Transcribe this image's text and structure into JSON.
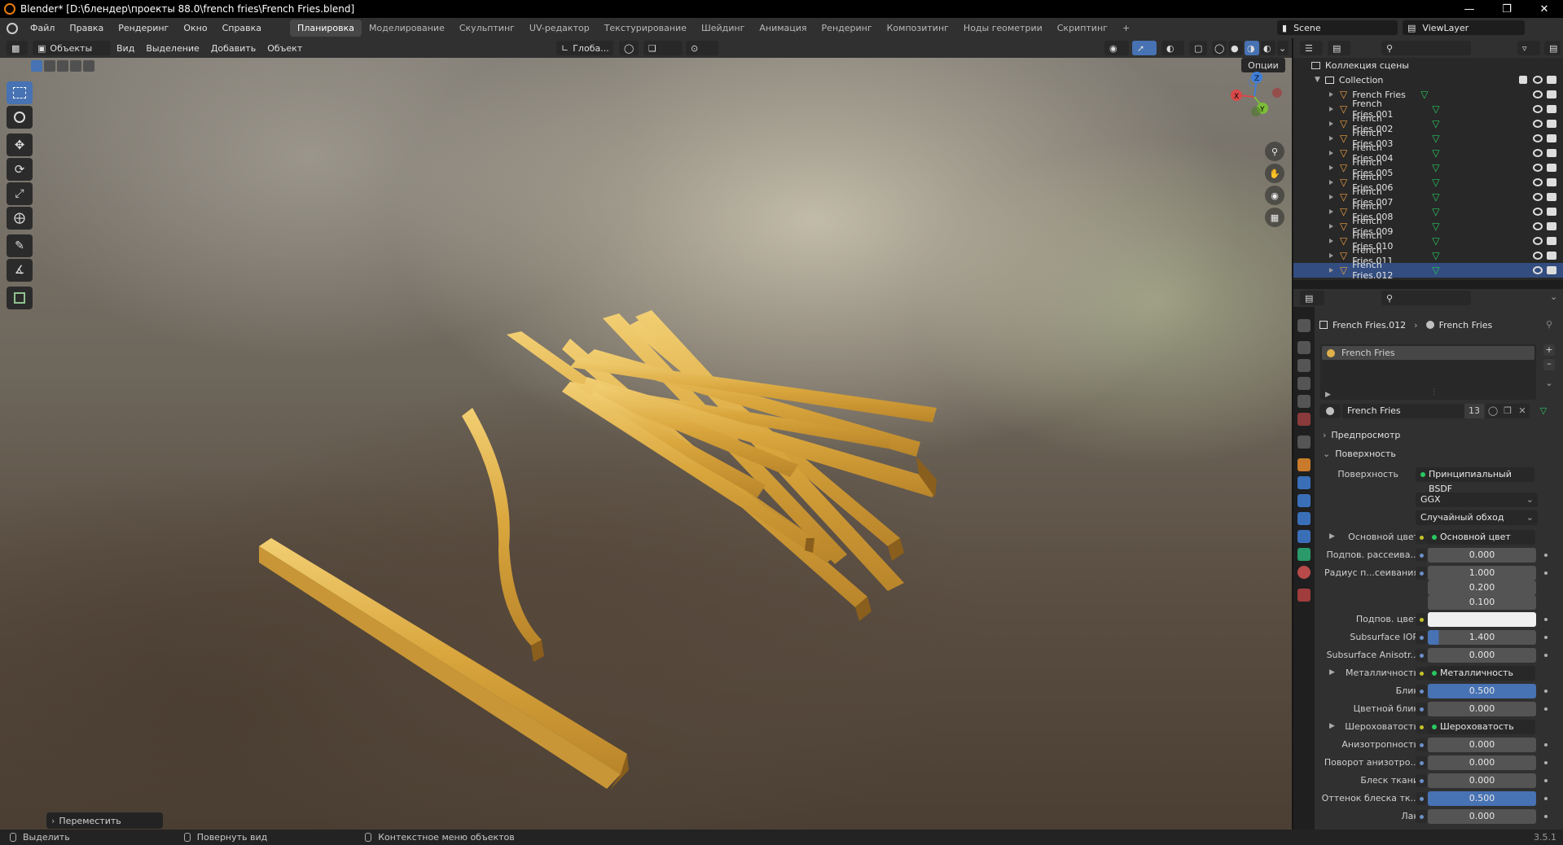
{
  "window": {
    "title": "Blender* [D:\\блендер\\проекты 88.0\\french fries\\French Fries.blend]"
  },
  "menu": {
    "items": [
      "Файл",
      "Правка",
      "Рендеринг",
      "Окно",
      "Справка"
    ]
  },
  "workspaces": {
    "tabs": [
      "Планировка",
      "Моделирование",
      "Скульптинг",
      "UV-редактор",
      "Текстурирование",
      "Шейдинг",
      "Анимация",
      "Рендеринг",
      "Композитинг",
      "Ноды геометрии",
      "Скриптинг"
    ],
    "active": "Планировка",
    "add": "+"
  },
  "scene": {
    "name": "Scene",
    "view_layer": "ViewLayer"
  },
  "viewport_header": {
    "mode": "Объекты",
    "menus": [
      "Вид",
      "Выделение",
      "Добавить",
      "Объект"
    ],
    "orientation": "Глоба...",
    "options": "Опции"
  },
  "last_operator": "Переместить",
  "outliner": {
    "root": "Коллекция сцены",
    "collection": "Collection",
    "items": [
      "French Fries",
      "French Fries.001",
      "French Fries.002",
      "French Fries.003",
      "French Fries.004",
      "French Fries.005",
      "French Fries.006",
      "French Fries.007",
      "French Fries.008",
      "French Fries.009",
      "French Fries.010",
      "French Fries.011",
      "French Fries.012"
    ],
    "selected": "French Fries.012"
  },
  "properties": {
    "breadcrumb_object": "French Fries.012",
    "breadcrumb_material": "French Fries",
    "slot_name": "French Fries",
    "material_name": "French Fries",
    "users": "13",
    "panel_preview": "Предпросмотр",
    "panel_surface": "Поверхность",
    "surface_label": "Поверхность",
    "surface_value": "Принципиальный BSDF",
    "distribution": "GGX",
    "subsurface_method": "Случайный обход",
    "rows": [
      {
        "label": "Основной цвет",
        "value": "Основной цвет",
        "kind": "link",
        "expand": true
      },
      {
        "label": "Подпов. рассеива...",
        "value": "0.000",
        "kind": "num"
      },
      {
        "label": "Радиус п...сеивания",
        "value": "1.000",
        "kind": "num"
      },
      {
        "label": "",
        "value": "0.200",
        "kind": "num"
      },
      {
        "label": "",
        "value": "0.100",
        "kind": "num"
      },
      {
        "label": "Подпов. цвет",
        "value": "",
        "kind": "color"
      },
      {
        "label": "Subsurface IOR",
        "value": "1.400",
        "kind": "num",
        "fill": 0.1
      },
      {
        "label": "Subsurface Anisotr...",
        "value": "0.000",
        "kind": "num"
      },
      {
        "label": "Металличность",
        "value": "Металличность",
        "kind": "link",
        "expand": true
      },
      {
        "label": "Блик",
        "value": "0.500",
        "kind": "num",
        "fill": 1
      },
      {
        "label": "Цветной блик",
        "value": "0.000",
        "kind": "num"
      },
      {
        "label": "Шероховатость",
        "value": "Шероховатость",
        "kind": "link",
        "expand": true
      },
      {
        "label": "Анизотропность",
        "value": "0.000",
        "kind": "num"
      },
      {
        "label": "Поворот анизотро...",
        "value": "0.000",
        "kind": "num"
      },
      {
        "label": "Блеск ткани",
        "value": "0.000",
        "kind": "num"
      },
      {
        "label": "Оттенок блеска тк...",
        "value": "0.500",
        "kind": "num",
        "fill": 1
      },
      {
        "label": "Лак",
        "value": "0.000",
        "kind": "num"
      }
    ]
  },
  "statusbar": {
    "select": "Выделить",
    "rotate": "Повернуть вид",
    "context": "Контекстное меню объектов",
    "version": "3.5.1"
  },
  "colors": {
    "accent": "#4772b3",
    "selected_row": "#334d80",
    "fries": "#e0b04a"
  }
}
